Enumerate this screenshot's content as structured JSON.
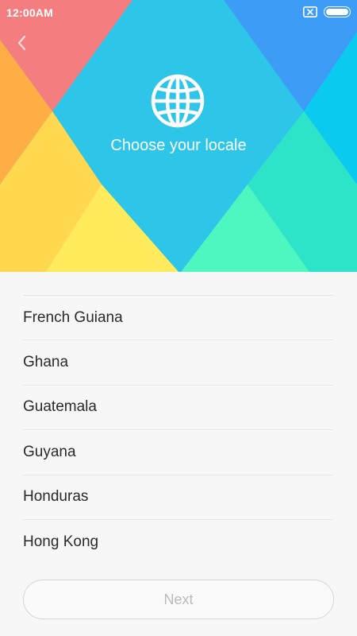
{
  "status_bar": {
    "time": "12:00AM",
    "icons": [
      "no-sim-icon",
      "battery-icon"
    ]
  },
  "header": {
    "back_icon": "chevron-left-icon",
    "globe_icon": "globe-icon",
    "title": "Choose your locale"
  },
  "locales": [
    {
      "label": "French Guiana"
    },
    {
      "label": "Ghana"
    },
    {
      "label": "Guatemala"
    },
    {
      "label": "Guyana"
    },
    {
      "label": "Honduras"
    },
    {
      "label": "Hong Kong"
    }
  ],
  "footer": {
    "next_label": "Next"
  },
  "colors": {
    "hero_blue": "#2ec6e8",
    "pink": "#f47d80",
    "orange": "#ffae45",
    "yellow": "#ffd84f",
    "pale_yellow": "#ffeb5c",
    "bright_blue": "#3c9cf6",
    "cyan": "#0bcaf0",
    "teal": "#2ee4c8",
    "mint": "#4df7bf",
    "background": "#f7f7f7"
  }
}
